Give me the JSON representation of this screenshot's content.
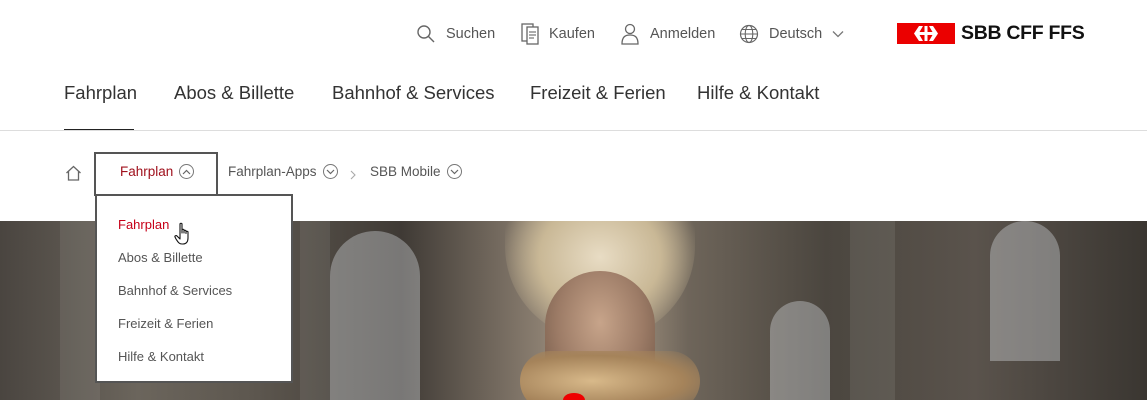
{
  "meta_nav": {
    "search_label": "Suchen",
    "buy_label": "Kaufen",
    "login_label": "Anmelden",
    "language_label": "Deutsch"
  },
  "logo": {
    "text": "SBB CFF FFS",
    "flag_color": "#eb0000"
  },
  "main_nav": {
    "items": [
      {
        "label": "Fahrplan",
        "active": true
      },
      {
        "label": "Abos & Billette"
      },
      {
        "label": "Bahnhof & Services"
      },
      {
        "label": "Freizeit & Ferien"
      },
      {
        "label": "Hilfe & Kontakt"
      }
    ]
  },
  "breadcrumb": {
    "home_icon": "home-icon",
    "items": [
      {
        "label": "Fahrplan",
        "active": true,
        "expanded": true
      },
      {
        "label": "Fahrplan-Apps"
      },
      {
        "label": "SBB Mobile"
      }
    ]
  },
  "dropdown": {
    "items": [
      {
        "label": "Fahrplan",
        "active": true
      },
      {
        "label": "Abos & Billette"
      },
      {
        "label": "Bahnhof & Services"
      },
      {
        "label": "Freizeit & Ferien"
      },
      {
        "label": "Hilfe & Kontakt"
      }
    ]
  },
  "colors": {
    "accent_red": "#c60018",
    "brand_red": "#eb0000"
  }
}
